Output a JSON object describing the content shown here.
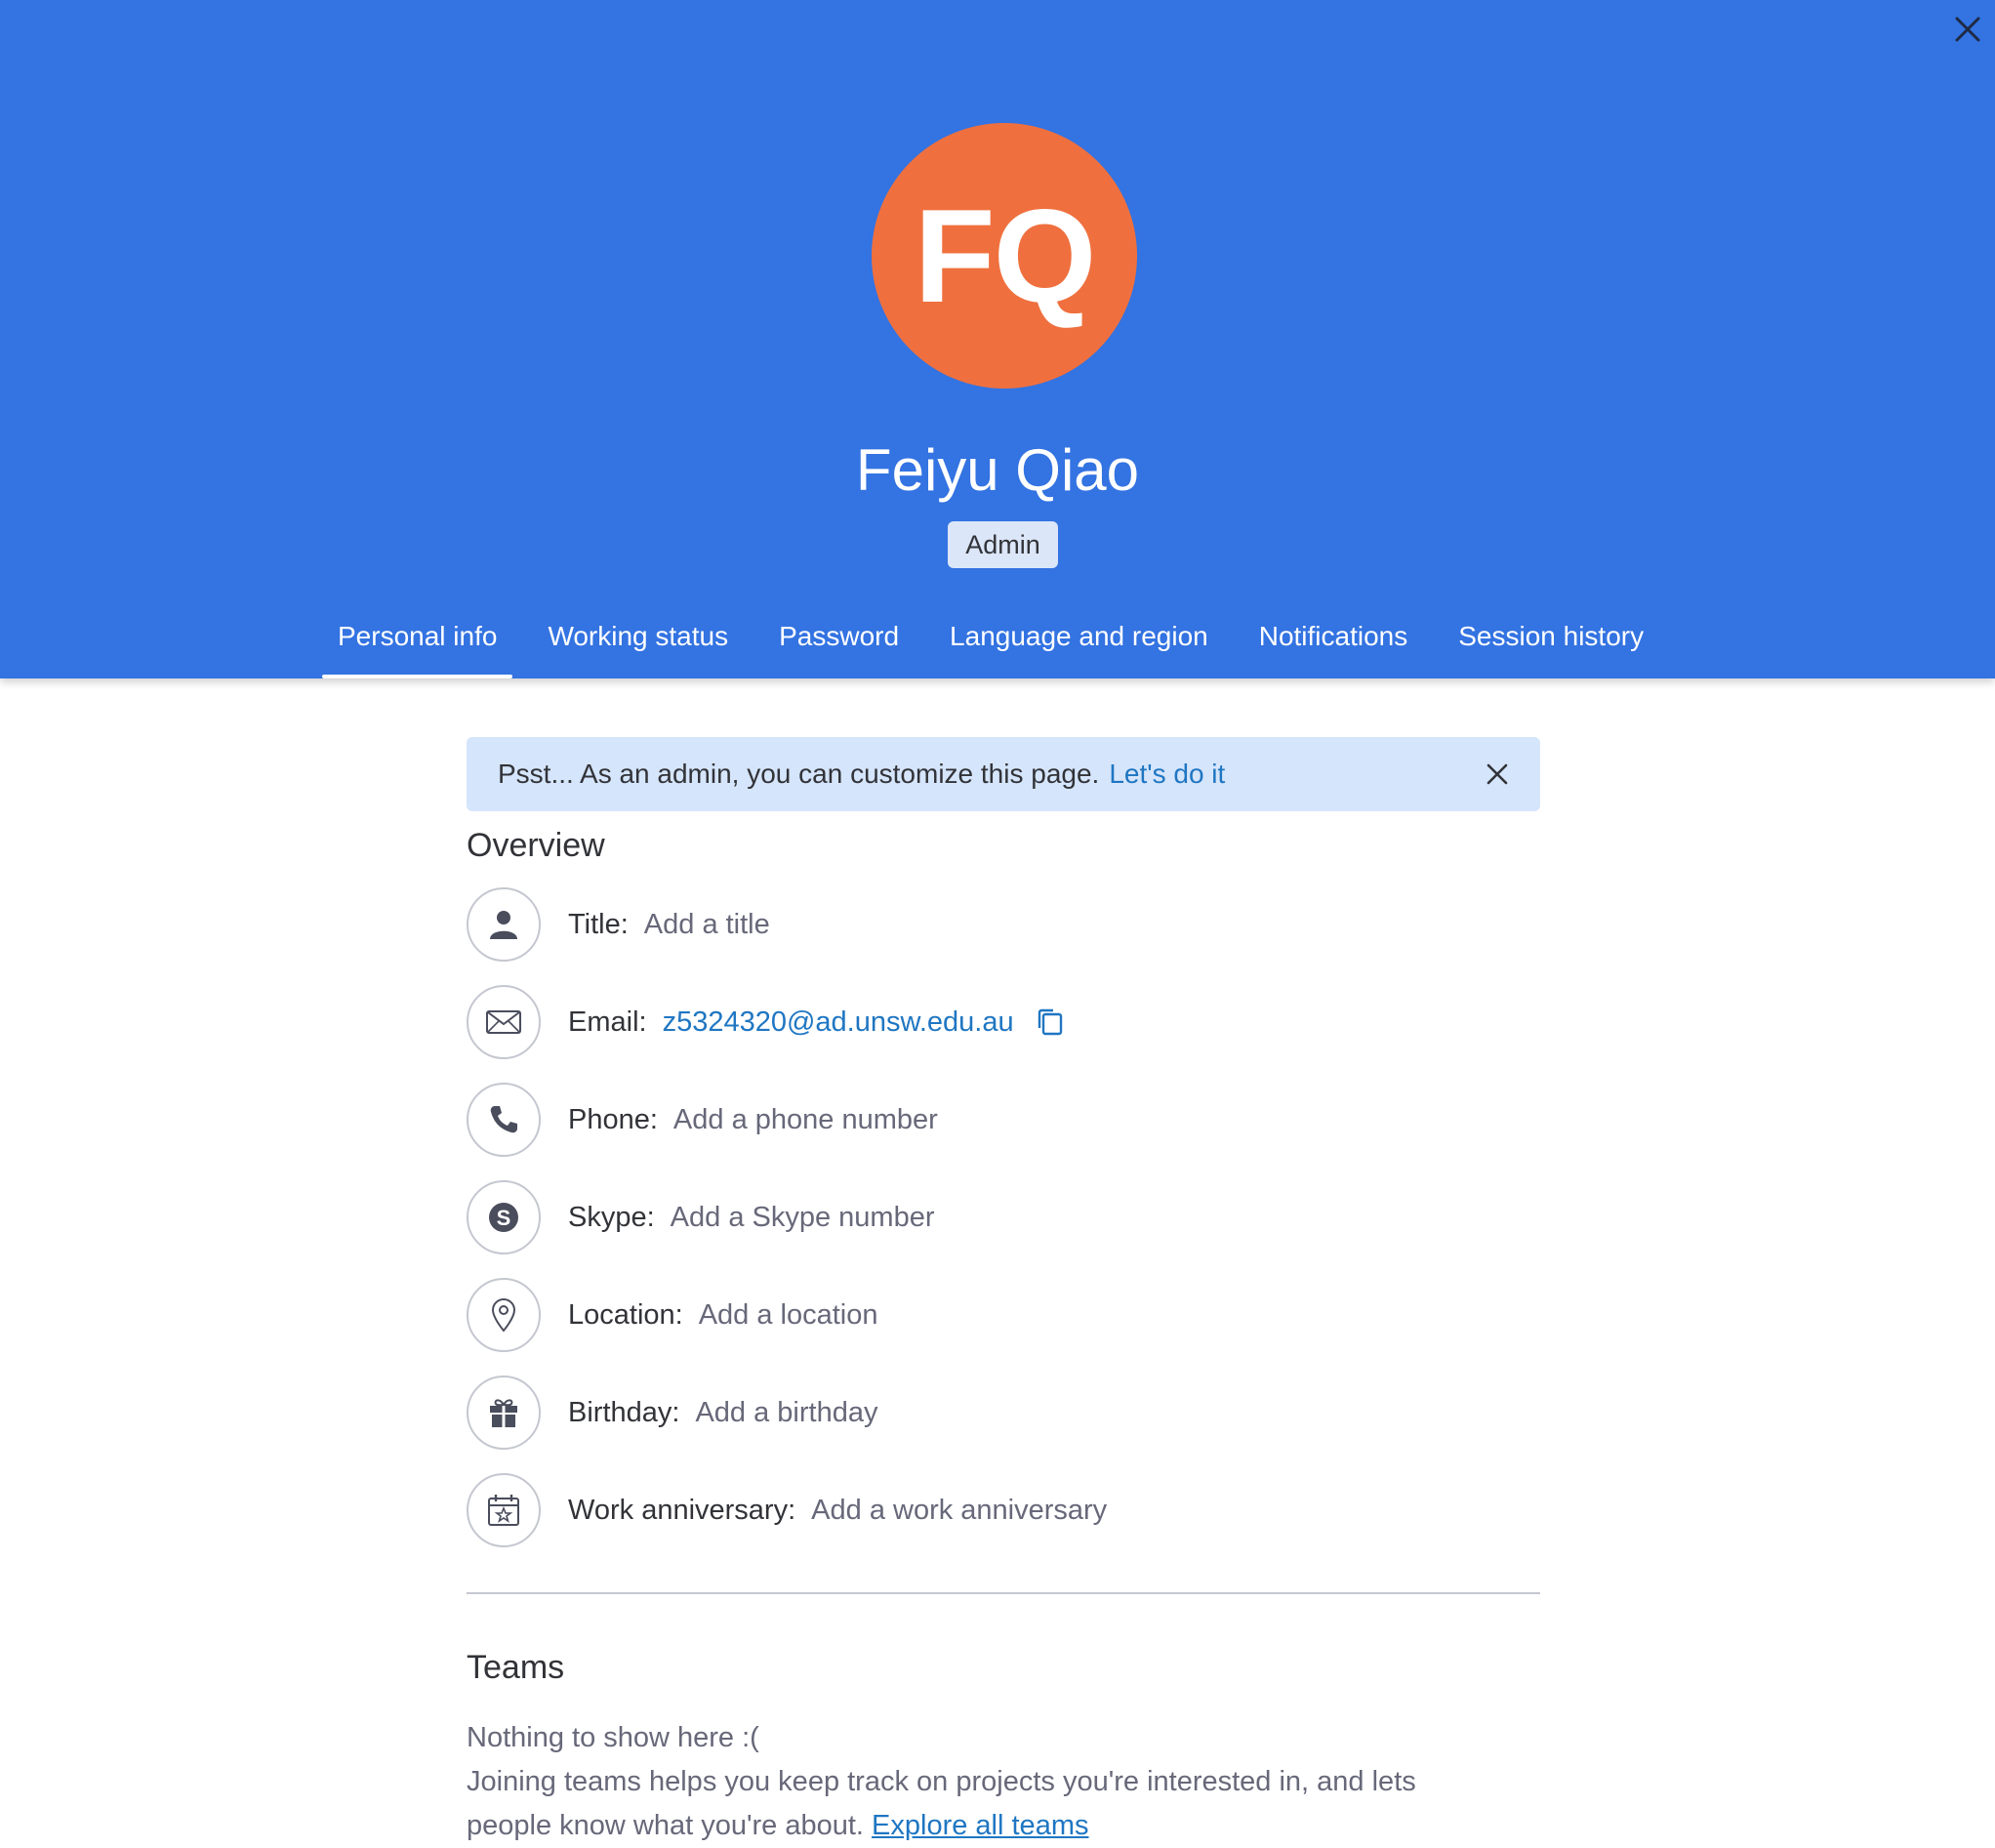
{
  "profile": {
    "initials": "FQ",
    "name": "Feiyu Qiao",
    "role": "Admin",
    "avatar_color": "#ef703e"
  },
  "header": {
    "background": "#3373e2"
  },
  "tabs": [
    {
      "label": "Personal info",
      "active": true
    },
    {
      "label": "Working status",
      "active": false
    },
    {
      "label": "Password",
      "active": false
    },
    {
      "label": "Language and region",
      "active": false
    },
    {
      "label": "Notifications",
      "active": false
    },
    {
      "label": "Session history",
      "active": false
    }
  ],
  "banner": {
    "text": "Psst... As an admin, you can customize this page.",
    "link": "Let's do it"
  },
  "overview": {
    "title": "Overview",
    "fields": [
      {
        "icon": "person-icon",
        "label": "Title:",
        "value": "Add a title"
      },
      {
        "icon": "envelope-icon",
        "label": "Email:",
        "value": "z5324320@ad.unsw.edu.au"
      },
      {
        "icon": "phone-icon",
        "label": "Phone:",
        "value": "Add a phone number"
      },
      {
        "icon": "skype-icon",
        "label": "Skype:",
        "value": "Add a Skype number"
      },
      {
        "icon": "location-pin-icon",
        "label": "Location:",
        "value": "Add a location"
      },
      {
        "icon": "gift-icon",
        "label": "Birthday:",
        "value": "Add a birthday"
      },
      {
        "icon": "calendar-star-icon",
        "label": "Work anniversary:",
        "value": "Add a work anniversary"
      }
    ]
  },
  "teams": {
    "title": "Teams",
    "empty_text": "Nothing to show here :(",
    "description": "Joining teams helps you keep track on projects you're interested in, and lets",
    "description_cont": "people know what you're about.",
    "link": "Explore all teams"
  }
}
